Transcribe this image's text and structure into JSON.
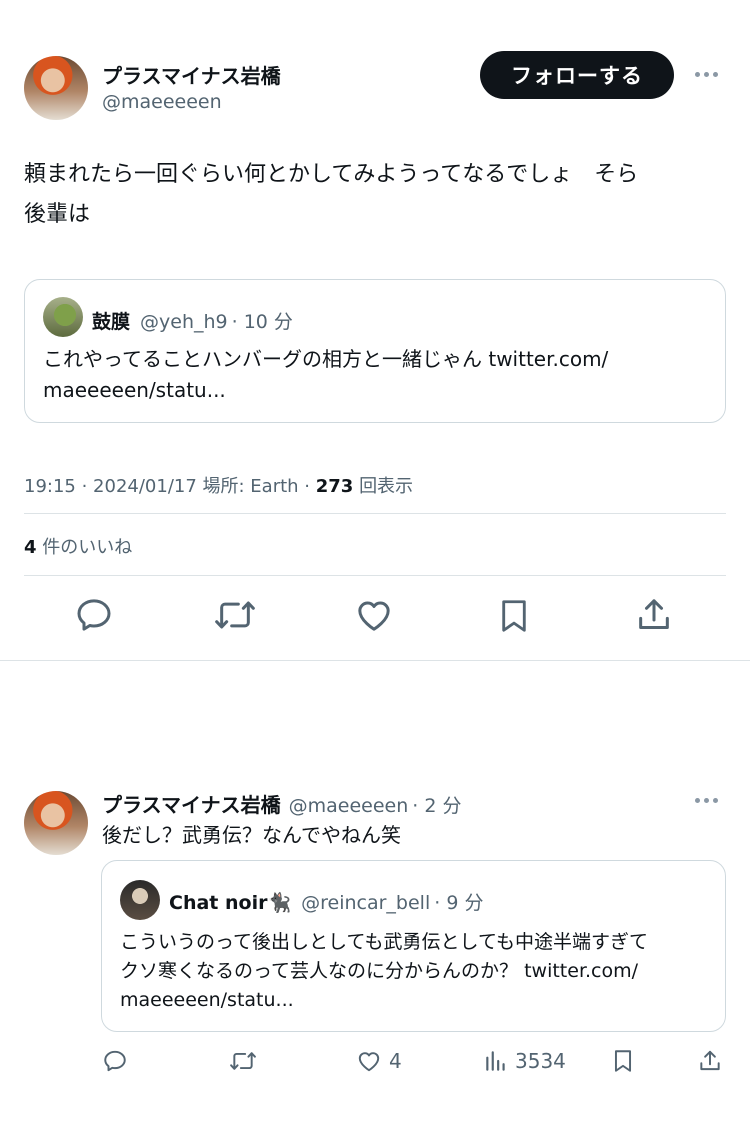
{
  "main_tweet": {
    "author_name": "プラスマイナス岩橋",
    "author_handle": "@maeeeeen",
    "follow_label": "フォローする",
    "text_line1": "頼まれたら一回ぐらい何とかしてみようってなるでしょ　そら",
    "text_line2": "後輩は",
    "quote": {
      "author_name": "鼓膜",
      "author_handle": "@yeh_h9",
      "time": "· 10 分",
      "text_line1": "これやってることハンバーグの相方と一緒じゃん twitter.com/",
      "text_line2": "maeeeeen/statu..."
    },
    "meta_time": "19:15 · 2024/01/17 場所: Earth ·",
    "views_count": "273",
    "views_label": "回表示",
    "likes_count": "4",
    "likes_label": "件のいいね"
  },
  "reply_tweet": {
    "author_name": "プラスマイナス岩橋",
    "author_handle": "@maeeeeen",
    "time": "· 2 分",
    "text": "後だし？武勇伝？なんでやねん笑",
    "quote": {
      "author_name": "Chat noir🐈‍⬛",
      "author_handle": "@reincar_bell",
      "time": "· 9 分",
      "text_line1": "こういうのって後出しとしても武勇伝としても中途半端すぎて",
      "text_line2": "クソ寒くなるのって芸人なのに分からんのか？ twitter.com/",
      "text_line3": "maeeeeen/statu..."
    },
    "likes": "4",
    "views": "3534"
  },
  "icons": {
    "reply": "reply-icon",
    "retweet": "retweet-icon",
    "like": "heart-icon",
    "bookmark": "bookmark-icon",
    "share": "share-icon",
    "more": "more-icon",
    "views": "views-icon"
  },
  "colors": {
    "text": "#0f1419",
    "secondary": "#536471",
    "border": "#cfd9de",
    "button": "#0f1419"
  }
}
